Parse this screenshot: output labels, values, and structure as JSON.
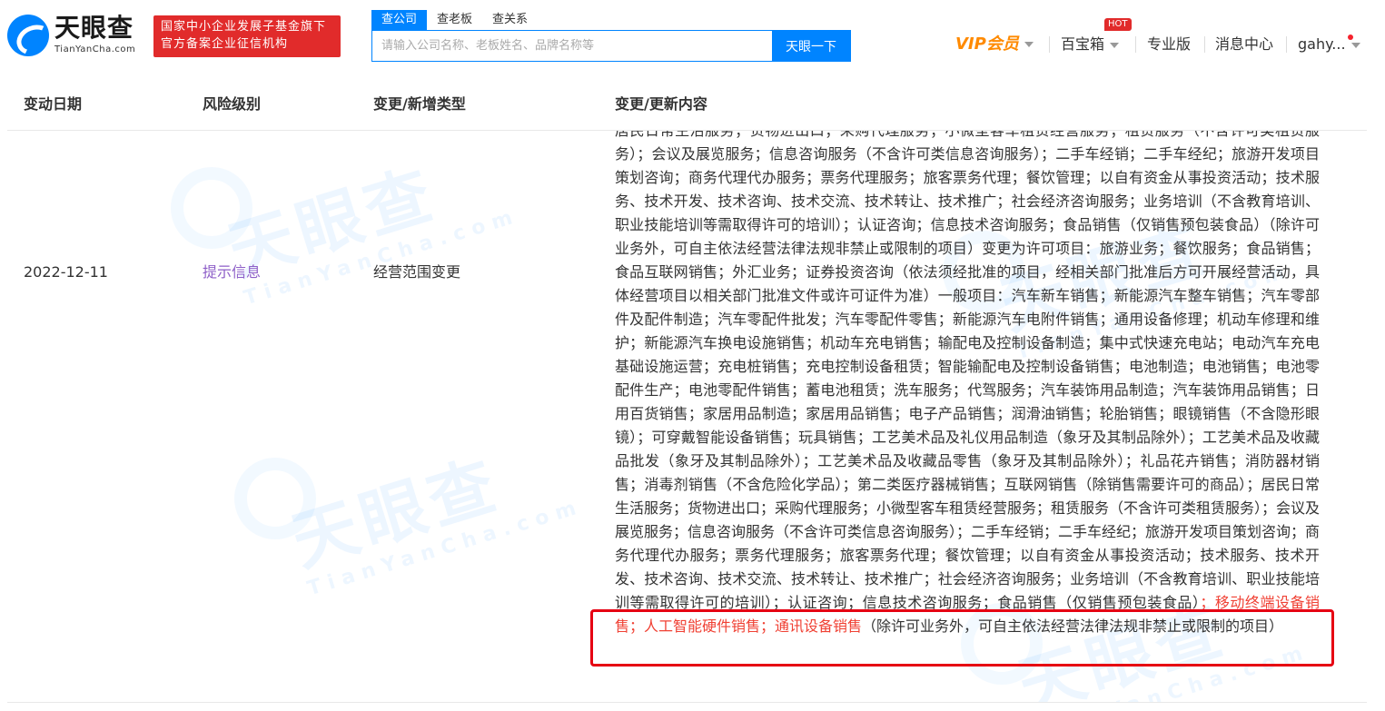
{
  "header": {
    "logo_cn": "天眼查",
    "logo_en": "TianYanCha.com",
    "badge_line1": "国家中小企业发展子基金旗下",
    "badge_line2": "官方备案企业征信机构",
    "search_tabs": [
      "查公司",
      "查老板",
      "查关系"
    ],
    "search_placeholder": "请输入公司名称、老板姓名、品牌名称等",
    "search_button": "天眼一下",
    "nav": {
      "vip": "VIP会员",
      "toolbox": "百宝箱",
      "hot": "HOT",
      "pro": "专业版",
      "messages": "消息中心",
      "user": "gahy..."
    }
  },
  "table": {
    "headers": [
      "变动日期",
      "风险级别",
      "变更/新增类型",
      "变更/更新内容"
    ],
    "row": {
      "date": "2022-12-11",
      "risk": "提示信息",
      "type": "经营范围变更",
      "content_before": "居民日常生活服务；货物进出口；采购代理服务；小微型客车租赁经营服务；租赁服务（不含许可类租赁服务）；会议及展览服务；信息咨询服务（不含许可类信息咨询服务）；二手车经销；二手车经纪；旅游开发项目策划咨询；商务代理代办服务；票务代理服务；旅客票务代理；餐饮管理；以自有资金从事投资活动；技术服务、技术开发、技术咨询、技术交流、技术转让、技术推广；社会经济咨询服务；业务培训（不含教育培训、职业技能培训等需取得许可的培训）；认证咨询；信息技术咨询服务；食品销售（仅销售预包装食品）（除许可业务外，可自主依法经营法律法规非禁止或限制的项目）变更为许可项目：旅游业务；餐饮服务；食品销售；食品互联网销售；外汇业务；证券投资咨询（依法须经批准的项目，经相关部门批准后方可开展经营活动，具体经营项目以相关部门批准文件或许可证件为准）一般项目：汽车新车销售；新能源汽车整车销售；汽车零部件及配件制造；汽车零配件批发；汽车零配件零售；新能源汽车电附件销售；通用设备修理；机动车修理和维护；新能源汽车换电设施销售；机动车充电销售；输配电及控制设备制造；集中式快速充电站；电动汽车充电基础设施运营；充电桩销售；充电控制设备租赁；智能输配电及控制设备销售；电池制造；电池销售；电池零配件生产；电池零配件销售；蓄电池租赁；洗车服务；代驾服务；汽车装饰用品制造；汽车装饰用品销售；日用百货销售；家居用品制造；家居用品销售；电子产品销售；润滑油销售；轮胎销售；眼镜销售（不含隐形眼镜）；可穿戴智能设备销售；玩具销售；工艺美术品及礼仪用品制造（象牙及其制品除外）；工艺美术品及收藏品批发（象牙及其制品除外）；工艺美术品及收藏品零售（象牙及其制品除外）；礼品花卉销售；消防器材销售；消毒剂销售（不含危险化学品）；第二类医疗器械销售；互联网销售（除销售需要许可的商品）；居民日常生活服务；货物进出口；采购代理服务；小微型客车租赁经营服务；租赁服务（不含许可类租赁服务）；会议及展览服务；信息咨询服务（不含许可类信息咨询服务）；二手车经销；二手车经纪；旅游开发项目策划咨询；商务代理代办服务；票务代理服务；旅客票务代理；餐饮管理；以自有资金从事投资活动；技术服务、技术开发、技术咨询、技术交流、技术转让、技术推广；社会经济咨询服务；业务培训（不含教育培训、职业技能培训等需取得许可的培训）；认证咨询；信息技术咨询服务；食品销售（仅销售预包装食品）",
      "content_highlight": "；移动终端设备销售；人工智能硬件销售；通讯设备销售",
      "content_after": "（除许可业务外，可自主依法经营法律法规非禁止或限制的项目）"
    }
  },
  "watermark": {
    "cn": "天眼查",
    "en": "TianYanCha.com"
  },
  "colors": {
    "brand_blue": "#0084ff",
    "vip_orange": "#ff8a00",
    "badge_red": "#e12b2b",
    "risk_purple": "#8e5fc8",
    "highlight_red": "#f04134",
    "box_red": "#e60012"
  }
}
